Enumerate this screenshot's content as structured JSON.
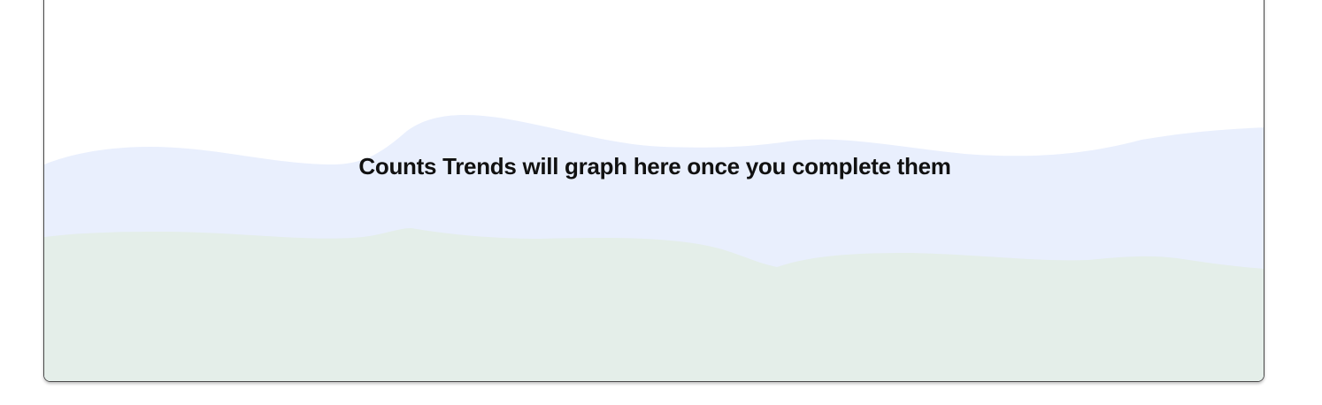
{
  "trends_panel": {
    "empty_message": "Counts Trends will graph here once you complete them"
  },
  "colors": {
    "back_hill": "#e9effd",
    "front_hill": "#e4eee9",
    "border": "#4a4a4a",
    "text": "#111111"
  },
  "icons": {
    "background": "hills-illustration"
  }
}
